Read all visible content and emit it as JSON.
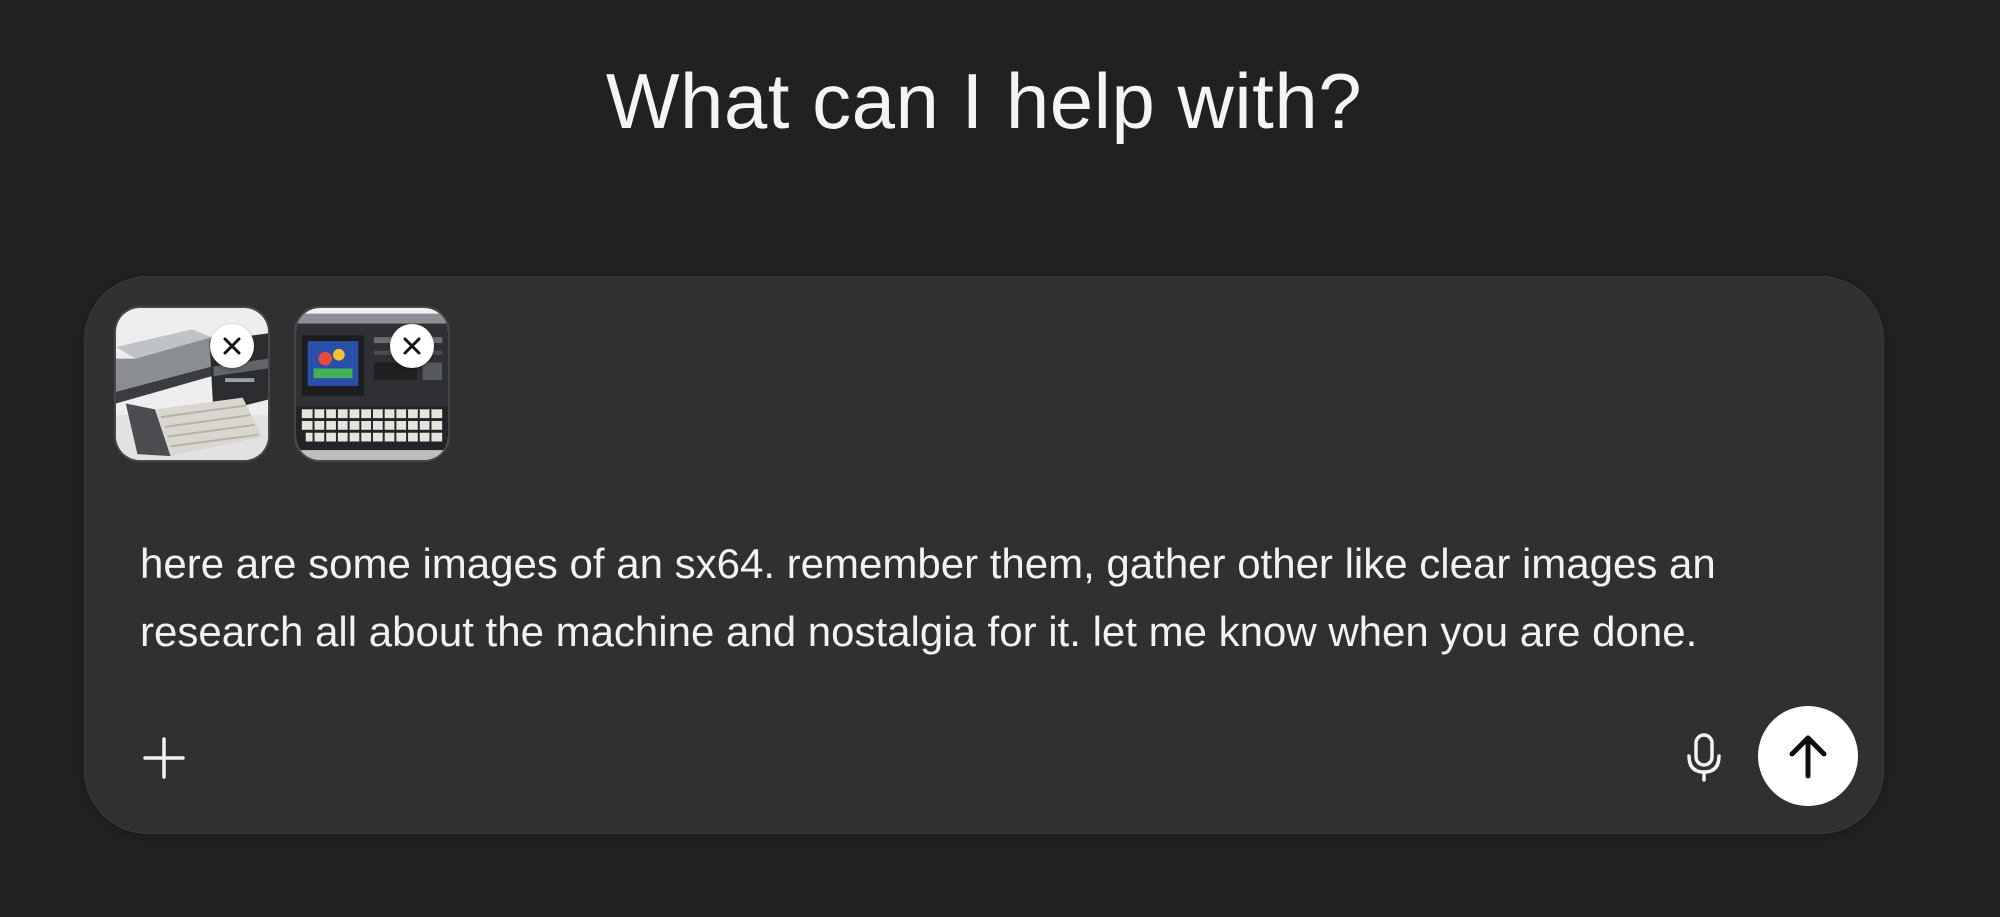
{
  "header": {
    "title": "What can I help with?"
  },
  "composer": {
    "attachments": [
      {
        "icon": "sx64-photo-thumbnail",
        "remove_icon": "close-icon"
      },
      {
        "icon": "sx64-photo-thumbnail",
        "remove_icon": "close-icon"
      }
    ],
    "prompt": "here are some images of an sx64. remember them, gather other like clear images an\nresearch all about the machine and nostalgia for it. let me know when you are done.",
    "add_icon": "plus-icon",
    "voice_icon": "microphone-icon",
    "send_icon": "arrow-up-icon"
  },
  "colors": {
    "background": "#212121",
    "composer": "#303030",
    "text": "#f2f2f2",
    "send_button": "#ffffff"
  }
}
